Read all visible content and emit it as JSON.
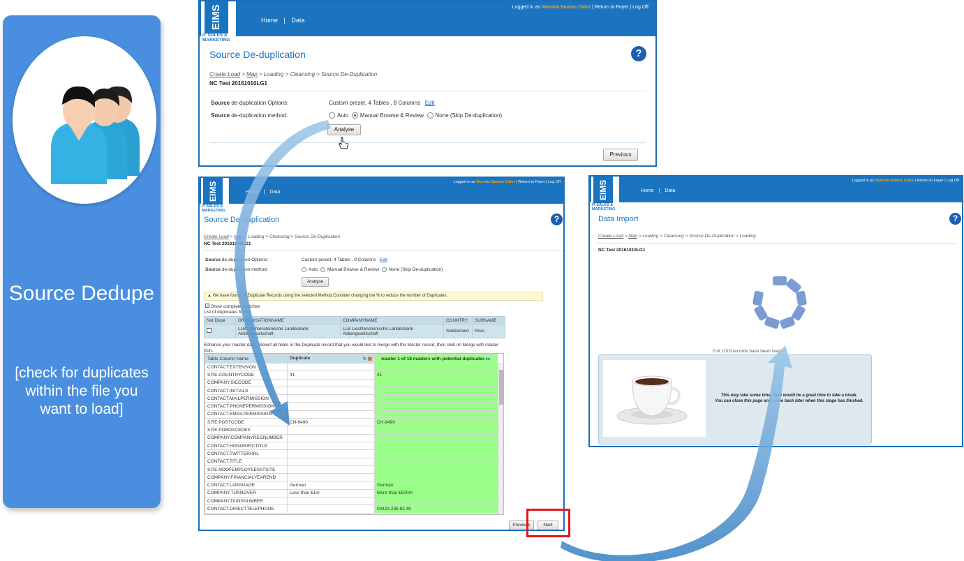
{
  "left_panel": {
    "title": "Source Dedupe",
    "description": "[check for duplicates within the file you want to load]"
  },
  "brand": {
    "logo": "EIMS",
    "sub_line1": "IT SALES &",
    "sub_line2": "MARKETING"
  },
  "nav": {
    "home": "Home",
    "data": "Data"
  },
  "login": {
    "prefix": "Logged in as",
    "user": "Noemia Santos Calor",
    "suffix": "| Return to Foyer | Log Off"
  },
  "win1": {
    "title": "Source De-duplication",
    "crumb_create": "Create Load",
    "crumb_map": "Map",
    "crumb_rest": "> Loading > Cleansing > Source De-Duplication",
    "load_name": "NC Test 20161010LG1",
    "options_label_bold": "Source",
    "options_label": "de-duplication Options:",
    "options_value": "Custom preset, 4 Tables , 8 Columns",
    "edit": "Edit",
    "method_label_bold": "Source",
    "method_label": "de-duplication method:",
    "radio_auto": "Auto",
    "radio_manual": "Manual Browse & Review",
    "radio_none": "None (Skip De-duplication)",
    "analyse": "Analyse",
    "previous": "Previous"
  },
  "win2": {
    "title": "Source De-duplication",
    "crumb_create": "Create Load",
    "crumb_map": "Map",
    "crumb_rest": "> Loading > Cleansing > Source De-Duplication",
    "load_name": "NC Test 20161010LG1",
    "options_label_bold": "Source",
    "options_label": "de-duplication Options:",
    "options_value": "Custom preset, 4 Tables , 8 Columns",
    "edit": "Edit",
    "method_label_bold": "Source",
    "method_label": "de-duplication method:",
    "radio_auto": "Auto",
    "radio_manual": "Manual Browse & Review",
    "radio_none": "None (Skip De-duplication)",
    "analyse": "Analyse",
    "warning": "We have found 16 Duplicate Records using the selected Method.Consider changing the % to reduce the number of Duplicates.",
    "show_complete": "Show complete matches",
    "list_label": "List of duplicates found",
    "dup_headers": [
      "Not Dupe",
      "ORGANISATIONNAME",
      "COMPANYNAME",
      "COUNTRY",
      "SURNAME"
    ],
    "dup_row": {
      "org": "LLB Liechtensteinische Landesbank Aktiengesellschaft",
      "company": "LLB Liechtensteinische Landesbank Aktiengesellschaft",
      "country": "Switzerland",
      "surname": "Rissi"
    },
    "enhance_text": "Enhance your master data - Select all fields in the Duplicate record that you would like to merge with the Master record, then click on Merge with master icon.",
    "grid_headers": [
      "Table Column Name",
      "Duplicate",
      "master 1 of 16 masters with potential duplicates"
    ],
    "grid_rows": [
      [
        "CONTACT.EXTENSION",
        "",
        ""
      ],
      [
        "SITE.COUNTRYCODE",
        "41",
        "41"
      ],
      [
        "COMPANY.SICCODE",
        "",
        ""
      ],
      [
        "CONTACT.INITIALS",
        "",
        ""
      ],
      [
        "CONTACT.MAILPERMISSION",
        "",
        ""
      ],
      [
        "CONTACT.PHONEPERMISSION",
        "",
        ""
      ],
      [
        "CONTACT.EMAILPERMISSION",
        "",
        ""
      ],
      [
        "SITE.POSTCODE",
        "CH-9490",
        "CH-9490"
      ],
      [
        "SITE.POBOXCEDEX",
        "",
        ""
      ],
      [
        "COMPANY.COMPANYREGNUMBER",
        "",
        ""
      ],
      [
        "CONTACT.HONORIFICTITLE",
        "",
        ""
      ],
      [
        "CONTACT.TWITTERURL",
        "",
        ""
      ],
      [
        "CONTACT.TITLE",
        "",
        ""
      ],
      [
        "SITE.NOOFEMPLOYEESATSITE",
        "",
        ""
      ],
      [
        "COMPANY.FINANCIALYEAREND",
        "",
        ""
      ],
      [
        "CONTACT.LANGUAGE",
        "German",
        "German"
      ],
      [
        "COMPANY.TURNOVER",
        "Less than €1m",
        "More than €500m"
      ],
      [
        "COMPANY.DUNSNUMBER",
        "",
        ""
      ],
      [
        "CONTACT.DIRECTTELEPHONE",
        "",
        "00423 236 83 49"
      ]
    ],
    "previous": "Previous",
    "next": "Next"
  },
  "win3": {
    "title": "Data Import",
    "crumb_create": "Create Load",
    "crumb_map": "Map",
    "crumb_rest": "> Loading > Cleansing > Source De-Duplication > Loading",
    "load_name": "NC Test 20161010LG1",
    "records_loaded": "0 of 1019 records have been loaded.",
    "break_line1": "This may take some time! Now would be a great time to take a break.",
    "break_line2": "You can close this page and come back later when this stage has finished."
  },
  "colors": {
    "brand_blue": "#1a74c0",
    "panel_blue": "#4a8fdf",
    "user_orange": "#f7a21b",
    "master_green": "#99ff88",
    "highlight_red": "#e3171b"
  }
}
